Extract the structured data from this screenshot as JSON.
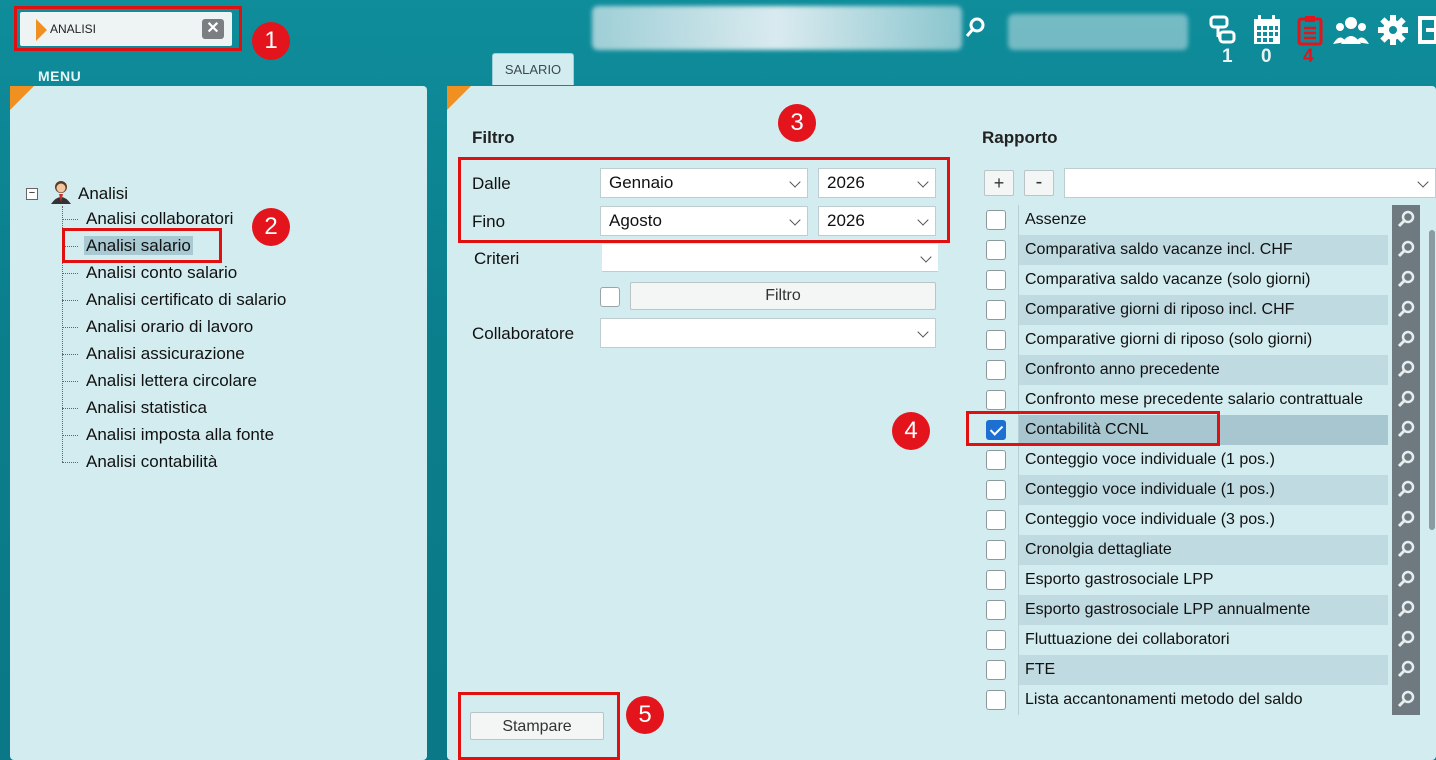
{
  "topbar": {
    "search_value": "ANALISI",
    "clear_symbol": "✕",
    "counters": [
      "1",
      "0",
      "4"
    ],
    "icons": [
      "network-icon",
      "calendar-icon",
      "clipboard-icon",
      "team-icon",
      "gear-icon",
      "logout-icon"
    ]
  },
  "annotations": [
    "1",
    "2",
    "3",
    "4",
    "5"
  ],
  "sidebar": {
    "menu_label": "MENU",
    "root_label": "Analisi",
    "items": [
      {
        "label": "Analisi collaboratori"
      },
      {
        "label": "Analisi salario",
        "selected": true
      },
      {
        "label": "Analisi conto salario"
      },
      {
        "label": "Analisi certificato di salario"
      },
      {
        "label": "Analisi orario di lavoro"
      },
      {
        "label": "Analisi assicurazione"
      },
      {
        "label": "Analisi lettera circolare"
      },
      {
        "label": "Analisi statistica"
      },
      {
        "label": "Analisi imposta alla fonte"
      },
      {
        "label": "Analisi contabilità"
      }
    ]
  },
  "tab": {
    "label": "SALARIO"
  },
  "filter": {
    "title": "Filtro",
    "from_label": "Dalle",
    "from_month": "Gennaio",
    "from_year": "2026",
    "to_label": "Fino",
    "to_month": "Agosto",
    "to_year": "2026",
    "criteria_label": "Criteri",
    "criteria_value": "",
    "filter_button": "Filtro",
    "employee_label": "Collaboratore",
    "employee_value": ""
  },
  "report": {
    "title": "Rapporto",
    "add_label": "+",
    "remove_label": "-",
    "select_value": "",
    "items": [
      {
        "label": "Assenze",
        "checked": false
      },
      {
        "label": "Comparativa saldo vacanze incl. CHF",
        "checked": false
      },
      {
        "label": "Comparativa saldo vacanze (solo giorni)",
        "checked": false
      },
      {
        "label": "Comparative giorni di riposo incl. CHF",
        "checked": false
      },
      {
        "label": "Comparative giorni di riposo (solo giorni)",
        "checked": false
      },
      {
        "label": "Confronto anno precedente",
        "checked": false
      },
      {
        "label": "Confronto mese precedente salario contrattuale",
        "checked": false
      },
      {
        "label": "Contabilità CCNL",
        "checked": true
      },
      {
        "label": "Conteggio voce individuale (1 pos.)",
        "checked": false
      },
      {
        "label": "Conteggio voce individuale (1 pos.)",
        "checked": false
      },
      {
        "label": "Conteggio voce individuale (3 pos.)",
        "checked": false
      },
      {
        "label": "Cronolgia dettagliate",
        "checked": false
      },
      {
        "label": "Esporto gastrosociale LPP",
        "checked": false
      },
      {
        "label": "Esporto gastrosociale LPP annualmente",
        "checked": false
      },
      {
        "label": "Fluttuazione dei collaboratori",
        "checked": false
      },
      {
        "label": "FTE",
        "checked": false
      },
      {
        "label": "Lista accantonamenti metodo del saldo",
        "checked": false
      }
    ]
  },
  "print_button": "Stampare",
  "colors": {
    "accent": "#f09020",
    "annotation": "#e3141b",
    "panel": "#d3ecef",
    "header": "#0f8d9b"
  }
}
